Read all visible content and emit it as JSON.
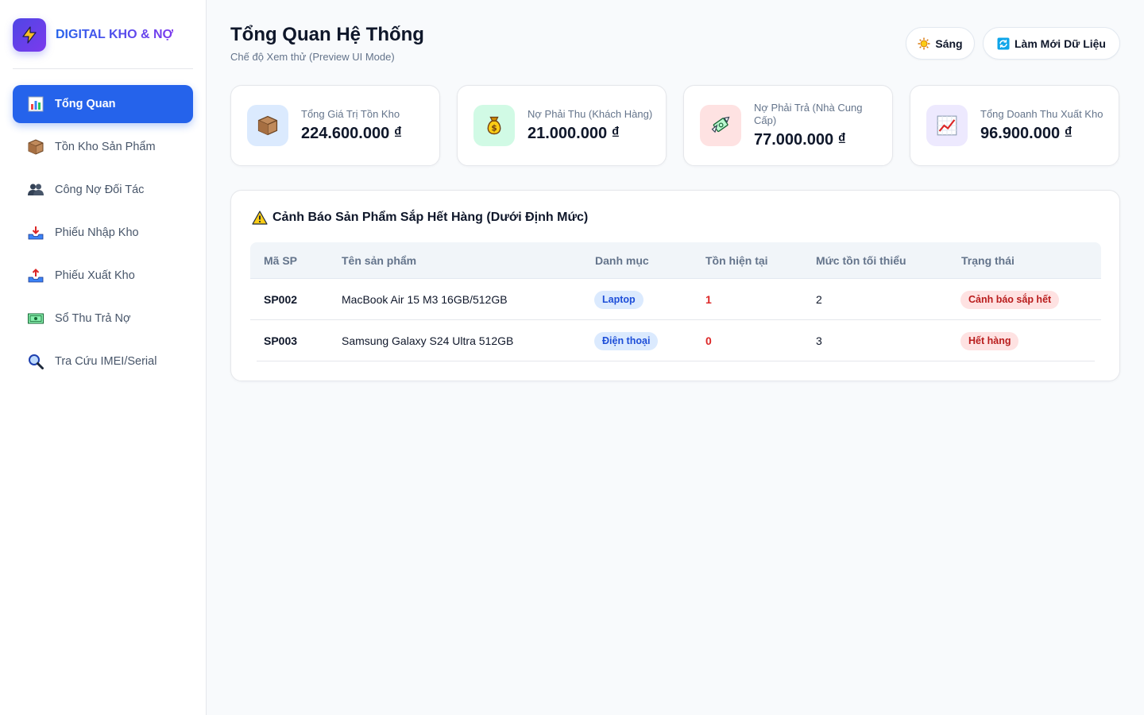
{
  "brand": {
    "name": "DIGITAL KHO & NỢ"
  },
  "sidebar": {
    "items": [
      {
        "label": "Tổng Quan",
        "icon": "bar-chart-icon",
        "active": true
      },
      {
        "label": "Tồn Kho Sản Phẩm",
        "icon": "package-icon"
      },
      {
        "label": "Công Nợ Đối Tác",
        "icon": "users-icon"
      },
      {
        "label": "Phiếu Nhập Kho",
        "icon": "inbox-tray-icon"
      },
      {
        "label": "Phiếu Xuất Kho",
        "icon": "outbox-tray-icon"
      },
      {
        "label": "Sổ Thu Trả Nợ",
        "icon": "ledger-icon"
      },
      {
        "label": "Tra Cứu IMEI/Serial",
        "icon": "magnifier-icon"
      }
    ]
  },
  "header": {
    "title": "Tổng Quan Hệ Thống",
    "subtitle": "Chế độ Xem thử (Preview UI Mode)",
    "theme_label": "Sáng",
    "refresh_label": "Làm Mới Dữ Liệu"
  },
  "stats": [
    {
      "label": "Tổng Giá Trị Tồn Kho",
      "value": "224.600.000 ₫",
      "icon": "package-icon",
      "color": "#dbeafe"
    },
    {
      "label": "Nợ Phải Thu (Khách Hàng)",
      "value": "21.000.000 ₫",
      "icon": "money-bag-icon",
      "color": "#d1fae5"
    },
    {
      "label": "Nợ Phải Trả (Nhà Cung Cấp)",
      "value": "77.000.000 ₫",
      "icon": "money-wings-icon",
      "color": "#fee2e2"
    },
    {
      "label": "Tổng Doanh Thu Xuất Kho",
      "value": "96.900.000 ₫",
      "icon": "chart-up-icon",
      "color": "#ede9fe"
    }
  ],
  "alert": {
    "title": "Cảnh Báo Sản Phẩm Sắp Hết Hàng (Dưới Định Mức)",
    "columns": [
      "Mã SP",
      "Tên sản phẩm",
      "Danh mục",
      "Tồn hiện tại",
      "Mức tồn tối thiểu",
      "Trạng thái"
    ],
    "rows": [
      {
        "code": "SP002",
        "name": "MacBook Air 15 M3 16GB/512GB",
        "category": "Laptop",
        "stock": "1",
        "min": "2",
        "status": "Cảnh báo sắp hết"
      },
      {
        "code": "SP003",
        "name": "Samsung Galaxy S24 Ultra 512GB",
        "category": "Điện thoại",
        "stock": "0",
        "min": "3",
        "status": "Hết hàng"
      }
    ]
  },
  "colors": {
    "accent": "#2563eb",
    "danger": "#dc2626",
    "brand_gradient": [
      "#2563eb",
      "#7c3aed"
    ]
  }
}
